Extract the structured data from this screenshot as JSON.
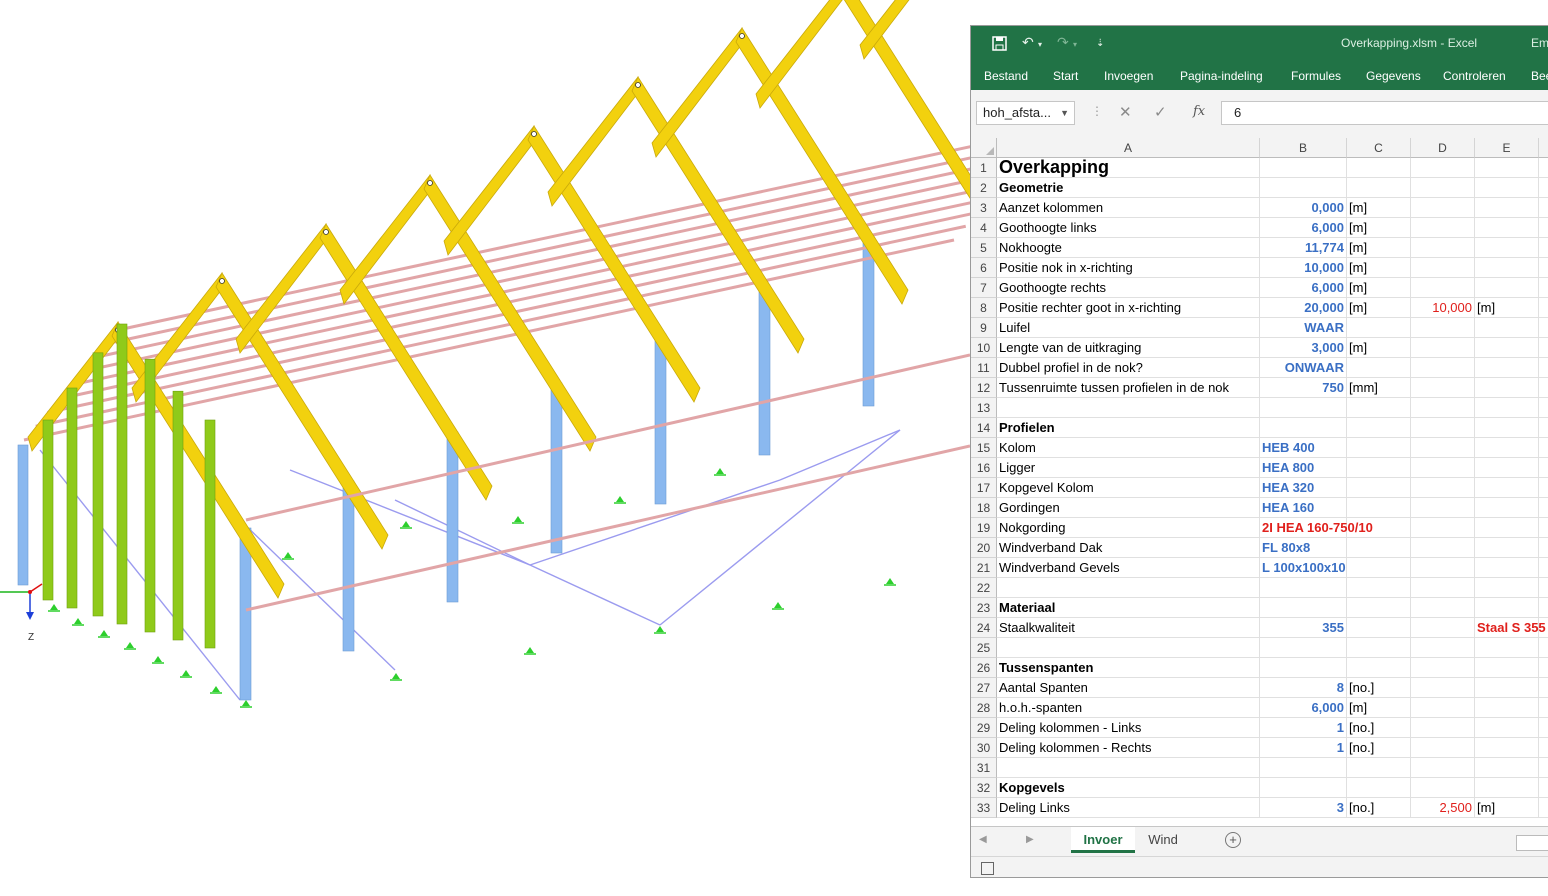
{
  "model": {
    "axis_label": "Z"
  },
  "excel": {
    "title": "Overkapping.xlsm  -  Excel",
    "user": "Em",
    "qat_icons": [
      "save-icon",
      "undo-icon",
      "redo-icon",
      "customize-icon"
    ],
    "ribbon_tabs": [
      "Bestand",
      "Start",
      "Invoegen",
      "Pagina-indeling",
      "Formules",
      "Gegevens",
      "Controleren",
      "Bee"
    ],
    "name_box": "hoh_afsta...",
    "formula_value": "6",
    "fx_label": "fx",
    "columns": [
      "A",
      "B",
      "C",
      "D",
      "E"
    ],
    "rows": [
      {
        "n": "1",
        "a": "Overkapping",
        "b": "",
        "c": "",
        "d": "",
        "e": "",
        "style": "title"
      },
      {
        "n": "2",
        "a": "Geometrie",
        "b": "",
        "c": "",
        "d": "",
        "e": "",
        "style": "head"
      },
      {
        "n": "3",
        "a": "Aanzet kolommen",
        "b": "0,000",
        "c": "[m]",
        "d": "",
        "e": ""
      },
      {
        "n": "4",
        "a": "Goothoogte links",
        "b": "6,000",
        "c": "[m]",
        "d": "",
        "e": ""
      },
      {
        "n": "5",
        "a": "Nokhoogte",
        "b": "11,774",
        "c": "[m]",
        "d": "",
        "e": ""
      },
      {
        "n": "6",
        "a": "Positie nok in x-richting",
        "b": "10,000",
        "c": "[m]",
        "d": "",
        "e": ""
      },
      {
        "n": "7",
        "a": "Goothoogte rechts",
        "b": "6,000",
        "c": "[m]",
        "d": "",
        "e": ""
      },
      {
        "n": "8",
        "a": "Positie rechter goot in x-richting",
        "b": "20,000",
        "c": "[m]",
        "d": "10,000",
        "e": "[m]"
      },
      {
        "n": "9",
        "a": "Luifel",
        "b": "WAAR",
        "c": "",
        "d": "",
        "e": ""
      },
      {
        "n": "10",
        "a": "Lengte van de uitkraging",
        "b": "3,000",
        "c": "[m]",
        "d": "",
        "e": ""
      },
      {
        "n": "11",
        "a": "Dubbel profiel in de nok?",
        "b": "ONWAAR",
        "c": "",
        "d": "",
        "e": ""
      },
      {
        "n": "12",
        "a": "Tussenruimte tussen profielen in de nok",
        "b": "750",
        "c": "[mm]",
        "d": "",
        "e": ""
      },
      {
        "n": "13",
        "a": "",
        "b": "",
        "c": "",
        "d": "",
        "e": ""
      },
      {
        "n": "14",
        "a": "Profielen",
        "b": "",
        "c": "",
        "d": "",
        "e": "",
        "style": "head"
      },
      {
        "n": "15",
        "a": "Kolom",
        "b": "HEB 400",
        "c": "",
        "d": "",
        "e": "",
        "bstyle": "bluel"
      },
      {
        "n": "16",
        "a": "Ligger",
        "b": "HEA 800",
        "c": "",
        "d": "",
        "e": "",
        "bstyle": "bluel"
      },
      {
        "n": "17",
        "a": "Kopgevel Kolom",
        "b": "HEA 320",
        "c": "",
        "d": "",
        "e": "",
        "bstyle": "bluel"
      },
      {
        "n": "18",
        "a": "Gordingen",
        "b": "HEA 160",
        "c": "",
        "d": "",
        "e": "",
        "bstyle": "bluel"
      },
      {
        "n": "19",
        "a": "Nokgording",
        "b": "2I HEA 160-750/10",
        "c": "",
        "d": "",
        "e": "",
        "bstyle": "redbl"
      },
      {
        "n": "20",
        "a": "Windverband Dak",
        "b": "FL 80x8",
        "c": "",
        "d": "",
        "e": "",
        "bstyle": "bluel"
      },
      {
        "n": "21",
        "a": "Windverband Gevels",
        "b": "L 100x100x10",
        "c": "",
        "d": "",
        "e": "",
        "bstyle": "bluel"
      },
      {
        "n": "22",
        "a": "",
        "b": "",
        "c": "",
        "d": "",
        "e": ""
      },
      {
        "n": "23",
        "a": "Materiaal",
        "b": "",
        "c": "",
        "d": "",
        "e": "",
        "style": "head"
      },
      {
        "n": "24",
        "a": "Staalkwaliteit",
        "b": "355",
        "c": "",
        "d": "",
        "e": "Staal S 355",
        "estyle": "redb"
      },
      {
        "n": "25",
        "a": "",
        "b": "",
        "c": "",
        "d": "",
        "e": ""
      },
      {
        "n": "26",
        "a": "Tussenspanten",
        "b": "",
        "c": "",
        "d": "",
        "e": "",
        "style": "head"
      },
      {
        "n": "27",
        "a": "Aantal Spanten",
        "b": "8",
        "c": "[no.]",
        "d": "",
        "e": ""
      },
      {
        "n": "28",
        "a": "h.o.h.-spanten",
        "b": "6,000",
        "c": "[m]",
        "d": "",
        "e": ""
      },
      {
        "n": "29",
        "a": "Deling kolommen - Links",
        "b": "1",
        "c": "[no.]",
        "d": "",
        "e": ""
      },
      {
        "n": "30",
        "a": "Deling kolommen - Rechts",
        "b": "1",
        "c": "[no.]",
        "d": "",
        "e": ""
      },
      {
        "n": "31",
        "a": "",
        "b": "",
        "c": "",
        "d": "",
        "e": ""
      },
      {
        "n": "32",
        "a": "Kopgevels",
        "b": "",
        "c": "",
        "d": "",
        "e": "",
        "style": "head"
      },
      {
        "n": "33",
        "a": "Deling Links",
        "b": "3",
        "c": "[no.]",
        "d": "2,500",
        "e": "[m]"
      }
    ],
    "sheet_tabs": [
      "Invoer",
      "Wind"
    ],
    "active_sheet": "Invoer",
    "colors": {
      "excel_green": "#217346",
      "blue_value": "#3a6fc4",
      "red_value": "#e0201c",
      "rafter": "#f2d10e",
      "column": "#8ab8ef",
      "gable_column": "#8fca1a",
      "purlin": "#e1a5a7",
      "bracing": "#9b9bef"
    }
  }
}
